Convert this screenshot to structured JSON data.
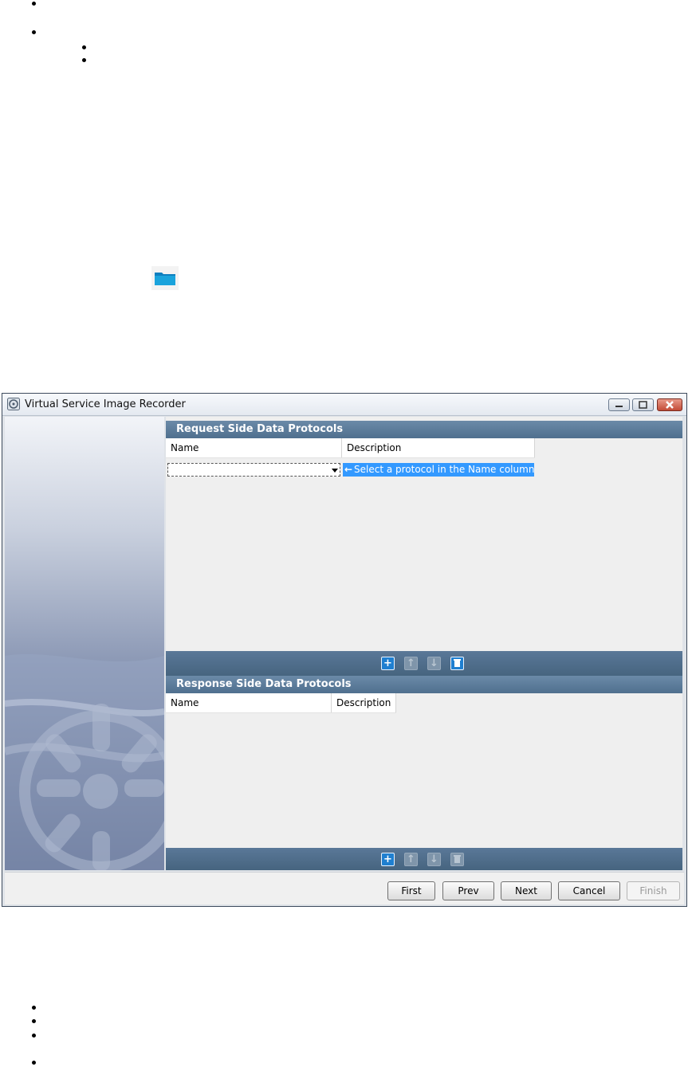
{
  "window": {
    "title": "Virtual Service Image Recorder"
  },
  "request_panel": {
    "title": "Request Side Data Protocols",
    "columns": [
      "Name",
      "Description"
    ],
    "edit_row": {
      "name_value": "",
      "hint": "Select a protocol in the Name column."
    }
  },
  "response_panel": {
    "title": "Response Side Data Protocols",
    "columns": [
      "Name",
      "Description"
    ]
  },
  "toolbar_icons": [
    "add-icon",
    "move-up-icon",
    "move-down-icon",
    "delete-icon"
  ],
  "footer": {
    "first": "First",
    "prev": "Prev",
    "next": "Next",
    "cancel": "Cancel",
    "finish": "Finish"
  },
  "colors": {
    "panel_header": "#5a7898",
    "hint_highlight": "#3399ff",
    "folder": "#1a9fd6"
  }
}
